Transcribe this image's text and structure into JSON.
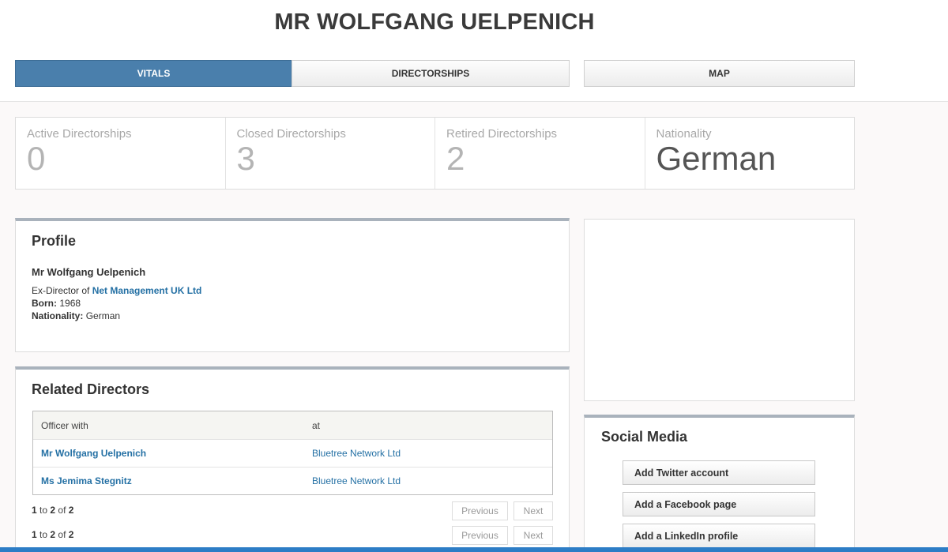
{
  "page": {
    "title": "MR WOLFGANG UELPENICH"
  },
  "tabs": [
    {
      "label": "VITALS",
      "active": true
    },
    {
      "label": "DIRECTORSHIPS",
      "active": false
    },
    {
      "label": "MAP",
      "active": false
    }
  ],
  "stats": [
    {
      "label": "Active Directorships",
      "value": "0"
    },
    {
      "label": "Closed Directorships",
      "value": "3"
    },
    {
      "label": "Retired Directorships",
      "value": "2"
    },
    {
      "label": "Nationality",
      "value": "German"
    }
  ],
  "profile": {
    "title": "Profile",
    "name": "Mr Wolfgang Uelpenich",
    "ex_director_prefix": "Ex-Director of",
    "company": "Net Management UK Ltd",
    "born_label": "Born:",
    "born_value": "1968",
    "nationality_label": "Nationality:",
    "nationality_value": "German"
  },
  "related": {
    "title": "Related Directors",
    "headers": [
      "Officer with",
      "at"
    ],
    "rows": [
      {
        "officer": "Mr Wolfgang Uelpenich",
        "company": "Bluetree Network Ltd"
      },
      {
        "officer": "Ms Jemima Stegnitz",
        "company": "Bluetree Network Ltd"
      }
    ],
    "pager": {
      "from": "1",
      "to_word": "to",
      "to": "2",
      "of_word": "of",
      "total": "2",
      "previous": "Previous",
      "next": "Next"
    }
  },
  "social": {
    "title": "Social Media",
    "buttons": [
      "Add Twitter account",
      "Add a Facebook page",
      "Add a LinkedIn profile"
    ]
  },
  "colors": {
    "accent": "#4a7fac",
    "link": "#2470a4",
    "bottom_bar": "#2d7dc6"
  }
}
